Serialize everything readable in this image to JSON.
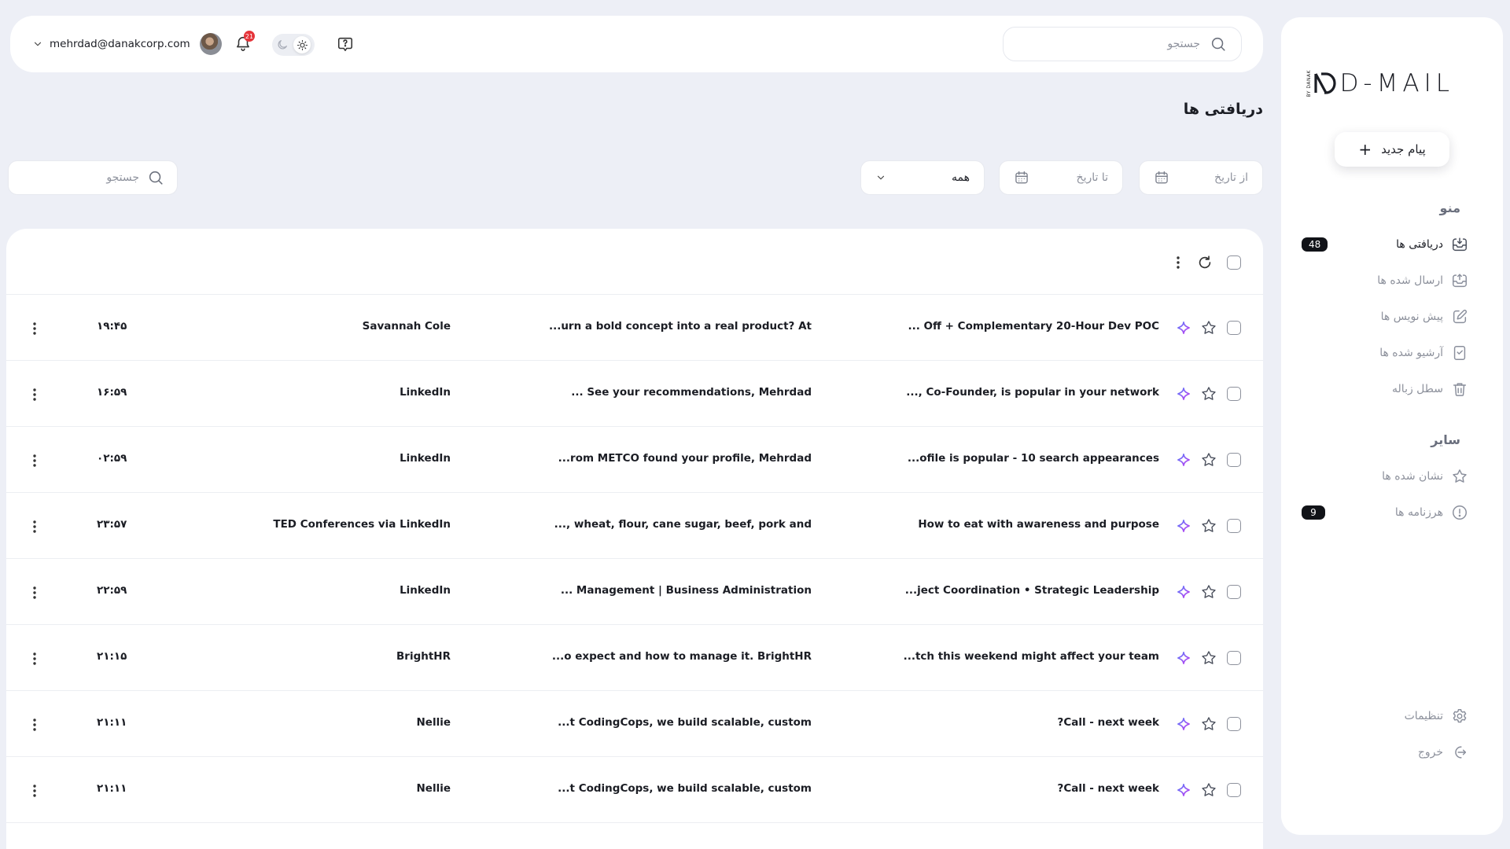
{
  "brand": {
    "logo_small": "BY DANAK",
    "logo_text": "D-MAIL"
  },
  "compose": {
    "label": "پیام جدید",
    "plus": "+"
  },
  "menu": {
    "title": "منو",
    "items": [
      {
        "label": "دریافتی ها",
        "icon": "inbox-icon",
        "count": "48",
        "active": true
      },
      {
        "label": "ارسال شده ها",
        "icon": "sent-icon"
      },
      {
        "label": "پیش نویس ها",
        "icon": "draft-icon"
      },
      {
        "label": "آرشیو شده ها",
        "icon": "archive-icon"
      },
      {
        "label": "سطل زباله",
        "icon": "trash-icon"
      }
    ]
  },
  "other": {
    "title": "سایر",
    "items": [
      {
        "label": "نشان شده ها",
        "icon": "star-icon"
      },
      {
        "label": "هرزنامه ها",
        "icon": "spam-icon",
        "count": "9"
      }
    ]
  },
  "footer_nav": {
    "settings": "تنظیمات",
    "logout": "خروج"
  },
  "topbar": {
    "search_placeholder": "جستجو",
    "user_email": "mehrdad@danakcorp.com",
    "notification_count": "21"
  },
  "page": {
    "title": "دریافتی ها",
    "from_date": "از تاریخ",
    "to_date": "تا تاریخ",
    "filter_value": "همه",
    "search_placeholder": "جستجو"
  },
  "colors": {
    "background": "#edeff6",
    "panel": "#ffffff",
    "badge_dark": "#111318",
    "notification": "#e5343a",
    "ai_gradient_start": "#5b7cfa",
    "ai_gradient_end": "#c13cf0"
  },
  "mails": [
    {
      "subject": "... Off + Complementary 20-Hour Dev POC",
      "snippet": "...urn a bold concept into a real product? At",
      "sender": "Savannah Cole",
      "time": "۱۹:۴۵"
    },
    {
      "subject": "..., Co-Founder, is popular in your network",
      "snippet": "...    See your recommendations, Mehrdad",
      "sender": "LinkedIn",
      "time": "۱۶:۵۹"
    },
    {
      "subject": "...ofile is popular - 10 search appearances",
      "snippet": "...rom METCO found your profile, Mehrdad",
      "sender": "LinkedIn",
      "time": "۰۲:۵۹"
    },
    {
      "subject": "How to eat with awareness and purpose",
      "snippet": "..., wheat, flour, cane sugar, beef, pork and",
      "sender": "TED Conferences via LinkedIn",
      "time": "۲۳:۵۷"
    },
    {
      "subject": "...ject Coordination • Strategic Leadership",
      "snippet": "... Management | Business Administration",
      "sender": "LinkedIn",
      "time": "۲۲:۵۹"
    },
    {
      "subject": "...tch this weekend might affect your team",
      "snippet": "...o expect and how to manage it. BrightHR",
      "sender": "BrightHR",
      "time": "۲۱:۱۵"
    },
    {
      "subject": "?Call - next week",
      "snippet": "...t CodingCops, we build scalable, custom",
      "sender": "Nellie",
      "time": "۲۱:۱۱"
    },
    {
      "subject": "?Call - next week",
      "snippet": "...t CodingCops, we build scalable, custom",
      "sender": "Nellie",
      "time": "۲۱:۱۱"
    }
  ]
}
